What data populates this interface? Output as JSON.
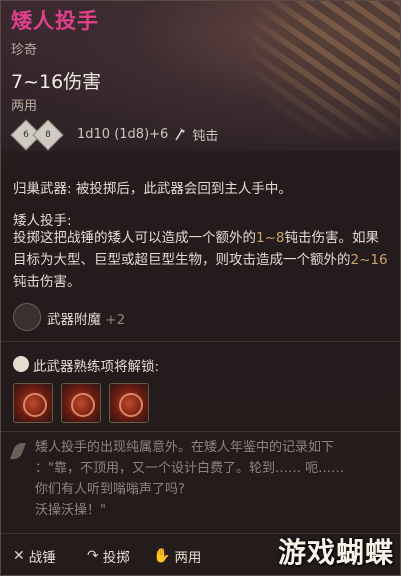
{
  "item": {
    "name": "矮人投手",
    "rarity": "珍奇",
    "damage": "7~16伤害",
    "handedness": "两用",
    "dice": {
      "die1": "6",
      "die2": "8"
    },
    "damage_formula": "1d10 (1d8)+6",
    "damage_type": "钝击"
  },
  "passive": {
    "return_label": "归巢武器",
    "return_text": ": 被投掷后，此武器会回到主人手中。"
  },
  "ability": {
    "title": "矮人投手:",
    "desc_a": "投掷这把战锤的矮人可以造成一个额外的",
    "desc_a_hl": "1~8",
    "desc_b": "钝击伤害。如果目标为大型、巨型或超巨型生物，则攻击造成一个额外的",
    "desc_b_hl": "2~16",
    "desc_c": "钝击伤害。"
  },
  "enchant": {
    "label": "武器附魔",
    "value": "+2"
  },
  "proficiency": {
    "label": "此武器熟练项将解锁:",
    "skills": [
      "skill-1",
      "skill-2",
      "skill-3"
    ]
  },
  "flavor": {
    "line1": "矮人投手的出现纯属意外。在矮人年鉴中的记录如下",
    "line2": "：\"靠，不顶用，又一个设计白费了。轮到…… 呃……",
    "line3": "你们有人听到嗡嗡声了吗?",
    "line4": "沃操沃操！\""
  },
  "footer": {
    "weapon_type": "战锤",
    "throw": "投掷",
    "hands": "两用"
  },
  "watermark": "游戏蝴蝶"
}
